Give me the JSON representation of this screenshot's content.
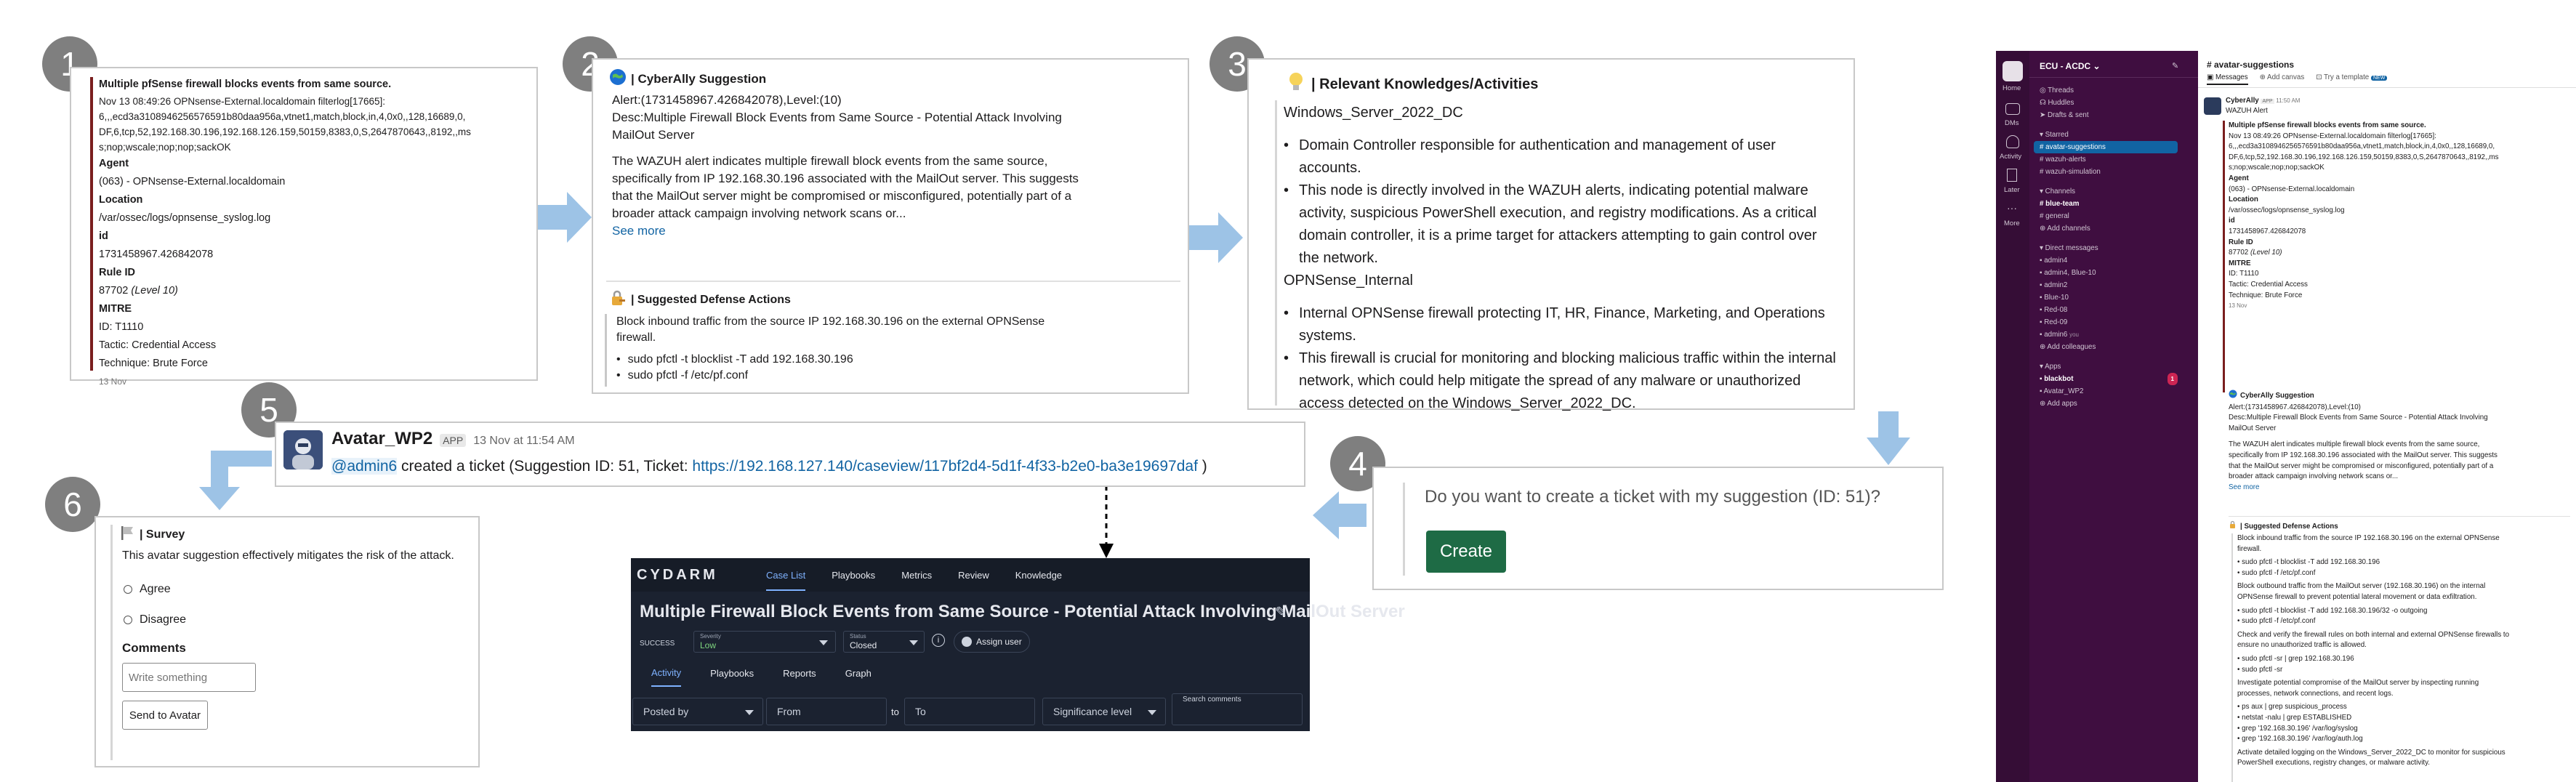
{
  "badges": [
    "1",
    "2",
    "3",
    "4",
    "5",
    "6"
  ],
  "alert": {
    "title": "Multiple pfSense firewall blocks events from same source.",
    "log_lines": [
      "Nov 13 08:49:26 OPNsense-External.localdomain filterlog[17665]:",
      "6,,,ecd3a3108946256576591b80daa956a,vtnet1,match,block,in,4,0x0,,128,16689,0,",
      "DF,6,tcp,52,192.168.30.196,192.168.126.159,50159,8383,0,S,2647870643,,8192,,ms",
      "s;nop;wscale;nop;nop;sackOK"
    ],
    "agent_label": "Agent",
    "agent_value": "(063) - OPNsense-External.localdomain",
    "location_label": "Location",
    "location_value": "/var/ossec/logs/opnsense_syslog.log",
    "id_label": "id",
    "id_value": "1731458967.426842078",
    "rule_label": "Rule ID",
    "rule_value": "87702",
    "rule_level": "(Level 10)",
    "mitre_label": "MITRE",
    "mitre_id": "ID: T1110",
    "mitre_tactic": "Tactic: Credential Access",
    "mitre_technique": "Technique: Brute Force",
    "date": "13 Nov"
  },
  "suggestion": {
    "title": "| CyberAlly Suggestion",
    "alert_line": "Alert:(1731458967.426842078),Level:(10)",
    "desc_line1": "Desc:Multiple Firewall Block Events from Same Source - Potential Attack Involving",
    "desc_line2": "MailOut Server",
    "body": [
      "The WAZUH alert indicates multiple firewall block events from the same source,",
      "specifically from IP 192.168.30.196 associated with the MailOut server. This suggests",
      "that the MailOut server might be compromised or misconfigured, potentially part of a",
      "broader attack campaign involving network scans or..."
    ],
    "see_more": "See more",
    "defense_title": "| Suggested Defense Actions",
    "defense_text": [
      "Block inbound traffic from the source IP 192.168.30.196 on the external OPNSense",
      "firewall."
    ],
    "commands": [
      "sudo pfctl -t blocklist -T add 192.168.30.196",
      "sudo pfctl -f /etc/pf.conf"
    ]
  },
  "knowledge": {
    "title": "| Relevant Knowledges/Activities",
    "host1": "Windows_Server_2022_DC",
    "host1_items": [
      [
        "Domain Controller responsible for authentication and management of user accounts."
      ],
      [
        "This node is directly involved in the WAZUH alerts, indicating potential malware",
        "activity, suspicious PowerShell execution, and registry modifications. As a critical",
        "domain controller, it is a prime target for attackers attempting to gain control over",
        "the network."
      ]
    ],
    "host2": "OPNSense_Internal",
    "host2_items": [
      [
        "Internal OPNSense firewall protecting IT, HR, Finance, Marketing, and Operations",
        "systems."
      ],
      [
        "This firewall is crucial for monitoring and blocking malicious traffic within the internal",
        "network, which could help mitigate the spread of any malware or unauthorized",
        "access detected on the Windows_Server_2022_DC."
      ]
    ]
  },
  "ticket_prompt": {
    "question": "Do you want to create a ticket with my suggestion (ID: 51)?",
    "button": "Create"
  },
  "avatar_msg": {
    "name": "Avatar_WP2",
    "app": "APP",
    "time": "13 Nov at 11:54 AM",
    "mention": "@admin6",
    "text": " created a ticket (Suggestion ID: 51, Ticket: ",
    "link": "https://192.168.127.140/caseview/117bf2d4-5d1f-4f33-b2e0-ba3e19697daf",
    "end": " )"
  },
  "survey": {
    "title": "| Survey",
    "text": "This avatar suggestion effectively mitigates the risk of the attack.",
    "options": [
      "Agree",
      "Disagree"
    ],
    "comments_label": "Comments",
    "placeholder": "Write something",
    "send": "Send to Avatar"
  },
  "cydarm": {
    "logo": "CYDARM",
    "nav": [
      "Case List",
      "Playbooks",
      "Metrics",
      "Review",
      "Knowledge"
    ],
    "title": "Multiple Firewall Block Events from Same Source - Potential Attack Involving MailOut Server",
    "success_label": "SUCCESS",
    "severity_label": "Severity",
    "severity_value": "Low",
    "status_label": "Status",
    "status_value": "Closed",
    "assign": "Assign user",
    "tabs": [
      "Activity",
      "Playbooks",
      "Reports",
      "Graph"
    ],
    "posted_by": "Posted by",
    "from": "From",
    "to_label": "to",
    "to": "To",
    "significance": "Significance level",
    "search_label": "Search comments"
  },
  "slack": {
    "workspace": "ECU - ACDC",
    "rail": [
      "Home",
      "DMs",
      "Activity",
      "Later",
      "More"
    ],
    "top_items": [
      "Threads",
      "Huddles",
      "Drafts & sent"
    ],
    "starred_label": "Starred",
    "starred": [
      "avatar-suggestions",
      "wazuh-alerts",
      "wazuh-simulation"
    ],
    "channels_label": "Channels",
    "channels": [
      "blue-team",
      "general"
    ],
    "add_channels": "Add channels",
    "dm_label": "Direct messages",
    "dms": [
      "admin4",
      "admin4, Blue-10",
      "admin2",
      "Blue-10",
      "Red-08",
      "Red-09",
      "admin6"
    ],
    "you": "you",
    "add_colleagues": "Add colleagues",
    "apps_label": "Apps",
    "apps": [
      "blackbot",
      "Avatar_WP2"
    ],
    "apps_badge": "1",
    "add_apps": "Add apps",
    "channel_title": "# avatar-suggestions",
    "header_tabs": [
      "Messages",
      "Add canvas",
      "Try a template"
    ],
    "new_badge": "NEW",
    "bot_name": "CyberAlly",
    "bot_app": "APP",
    "bot_time": "11:50 AM",
    "bot_sub": "WAZUH Alert",
    "sugg_title": "CyberAlly Suggestion",
    "sugg_alert": "Alert:(1731458967.426842078),Level:(10)",
    "sugg_desc": [
      "Desc:Multiple Firewall Block Events from Same Source - Potential Attack Involving",
      "MailOut Server"
    ],
    "sugg_body": [
      "The WAZUH alert indicates multiple firewall block events from the same source,",
      "specifically from IP 192.168.30.196 associated with the MailOut server. This suggests",
      "that the MailOut server might be compromised or misconfigured, potentially part of a",
      "broader attack campaign involving network scans or..."
    ],
    "see_more": "See more",
    "defense_title": "| Suggested Defense Actions",
    "defense_blocks": [
      {
        "text": [
          "Block inbound traffic from the source IP 192.168.30.196 on the external OPNSense",
          "firewall."
        ],
        "cmds": [
          "sudo pfctl -t blocklist -T add 192.168.30.196",
          "sudo pfctl -f /etc/pf.conf"
        ]
      },
      {
        "text": [
          "Block outbound traffic from the MailOut server (192.168.30.196) on the internal",
          "OPNSense firewall to prevent potential lateral movement or data exfiltration."
        ],
        "cmds": [
          "sudo pfctl -t blocklist -T add 192.168.30.196/32 -o outgoing",
          "sudo pfctl -f /etc/pf.conf"
        ]
      },
      {
        "text": [
          "Check and verify the firewall rules on both internal and external OPNSense firewalls to",
          "ensure no unauthorized traffic is allowed."
        ],
        "cmds": [
          "sudo pfctl -sr | grep 192.168.30.196",
          "sudo pfctl -sr"
        ]
      },
      {
        "text": [
          "Investigate potential compromise of the MailOut server by inspecting running",
          "processes, network connections, and recent logs."
        ],
        "cmds": [
          "ps aux | grep suspicious_process",
          "netstat -nalu | grep ESTABLISHED",
          "grep '192.168.30.196' /var/log/syslog",
          "grep '192.168.30.196' /var/log/auth.log"
        ]
      },
      {
        "text": [
          "Activate detailed logging on the Windows_Server_2022_DC to monitor for suspicious",
          "PowerShell executions, registry changes, or malware activity."
        ],
        "cmds": []
      }
    ]
  }
}
